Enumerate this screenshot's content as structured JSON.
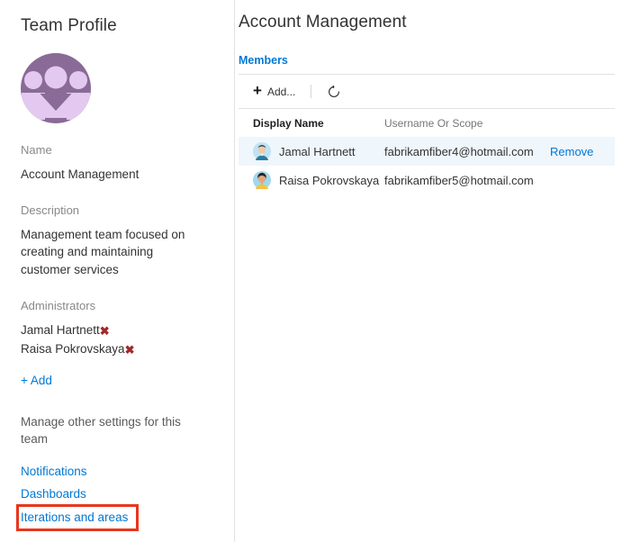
{
  "sidebar": {
    "title": "Team Profile",
    "avatar_icon": "team-group-avatar",
    "avatar_colors": {
      "circle": "#8a6a96",
      "figures": "#e3c8ef"
    },
    "fields": {
      "name_label": "Name",
      "name_value": "Account Management",
      "description_label": "Description",
      "description_value": "Management team focused on creating and maintaining customer services",
      "administrators_label": "Administrators"
    },
    "administrators": [
      {
        "name": "Jamal Hartnett",
        "remove_icon": "close-x-icon"
      },
      {
        "name": "Raisa Pokrovskaya",
        "remove_icon": "close-x-icon"
      }
    ],
    "add_admin_label": "+ Add",
    "manage_text": "Manage other settings for this team",
    "settings_links": [
      {
        "label": "Notifications",
        "highlighted": false
      },
      {
        "label": "Dashboards",
        "highlighted": false
      },
      {
        "label": "Iterations and areas",
        "highlighted": true
      }
    ],
    "highlight_color": "#e8361d",
    "link_color": "#0078d4"
  },
  "main": {
    "title": "Account Management",
    "tabs": [
      {
        "label": "Members",
        "active": true
      }
    ],
    "toolbar": {
      "add_label": "Add...",
      "add_icon": "plus-icon",
      "refresh_icon": "refresh-icon"
    },
    "table": {
      "columns": [
        "Display Name",
        "Username Or Scope",
        ""
      ],
      "rows": [
        {
          "avatar_icon": "user-avatar-male",
          "display_name": "Jamal Hartnett",
          "username": "fabrikamfiber4@hotmail.com",
          "action_label": "Remove",
          "selected": true
        },
        {
          "avatar_icon": "user-avatar-female",
          "display_name": "Raisa Pokrovskaya",
          "username": "fabrikamfiber5@hotmail.com",
          "action_label": "",
          "selected": false
        }
      ]
    }
  }
}
